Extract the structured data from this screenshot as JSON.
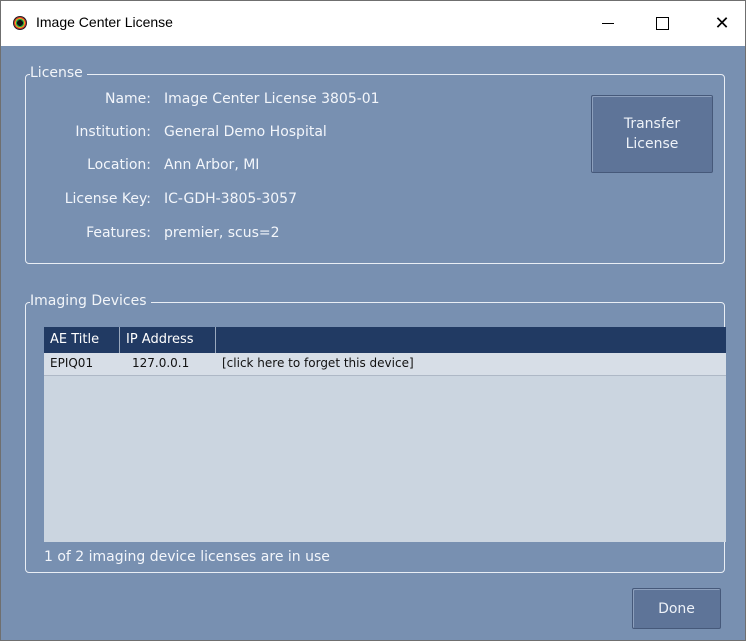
{
  "window": {
    "title": "Image Center License"
  },
  "license": {
    "legend": "License",
    "fields": [
      {
        "label": "Name:",
        "value": "Image Center License 3805-01"
      },
      {
        "label": "Institution:",
        "value": "General Demo Hospital"
      },
      {
        "label": "Location:",
        "value": "Ann Arbor, MI"
      },
      {
        "label": "License Key:",
        "value": "IC-GDH-3805-3057"
      },
      {
        "label": "Features:",
        "value": "premier, scus=2"
      }
    ],
    "transfer_label_1": "Transfer",
    "transfer_label_2": "License"
  },
  "devices": {
    "legend": "Imaging Devices",
    "columns": [
      "AE Title",
      "IP Address",
      ""
    ],
    "rows": [
      {
        "ae_title": "EPIQ01",
        "ip": "127.0.0.1",
        "action": "[click here to forget this device]"
      }
    ],
    "usage_text": "1 of 2 imaging device licenses are in use"
  },
  "footer": {
    "done_label": "Done"
  },
  "icons": {
    "app": "app-logo-icon",
    "minimize": "minimize-icon",
    "maximize": "maximize-icon",
    "close": "close-icon"
  }
}
